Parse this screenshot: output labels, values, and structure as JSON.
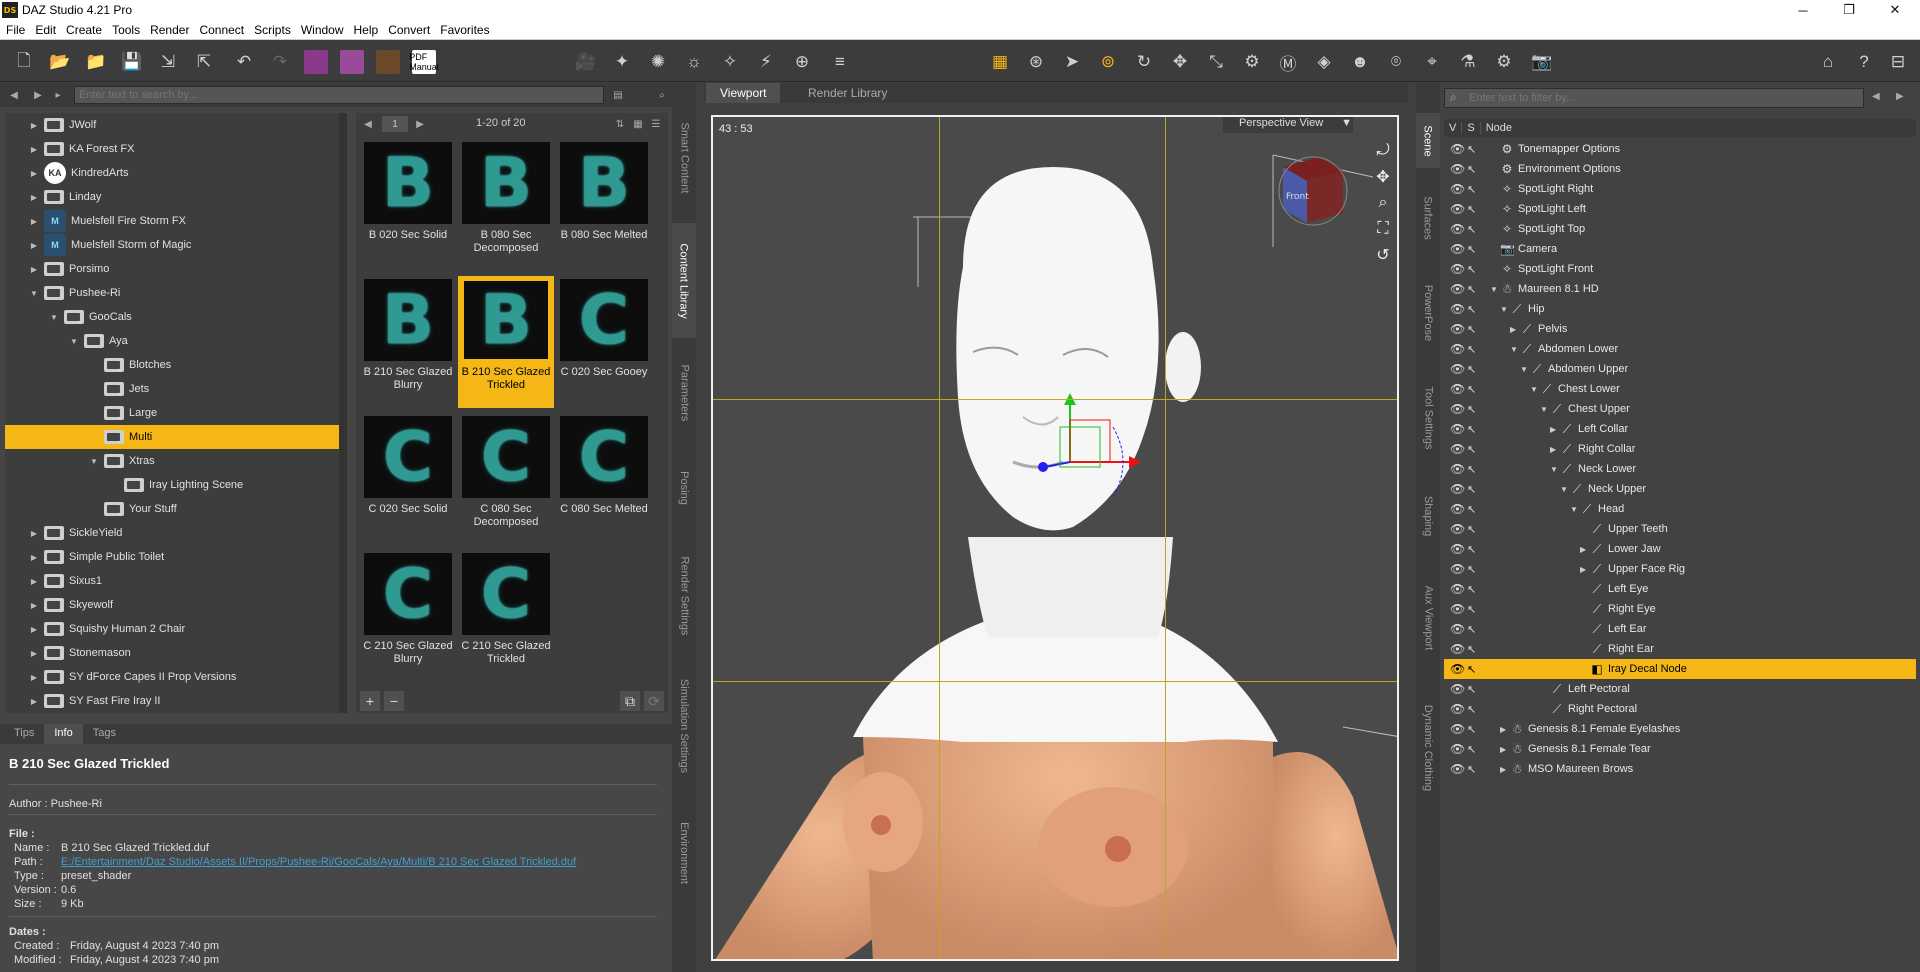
{
  "window": {
    "title": "DAZ Studio 4.21 Pro",
    "logo": "DS",
    "minimize": "─",
    "maximize": "❐",
    "close": "✕"
  },
  "menu": [
    "File",
    "Edit",
    "Create",
    "Tools",
    "Render",
    "Connect",
    "Scripts",
    "Window",
    "Help",
    "Convert",
    "Favorites"
  ],
  "toolbar": {
    "pdf_label": "PDF Manual"
  },
  "content": {
    "search_placeholder": "Enter text to search by...",
    "tree": [
      {
        "label": "JWolf",
        "depth": 0,
        "expander": "▶",
        "icon": "folder"
      },
      {
        "label": "KA Forest FX",
        "depth": 0,
        "expander": "▶",
        "icon": "folder"
      },
      {
        "label": "KindredArts",
        "depth": 0,
        "expander": "▶",
        "icon": "ka-logo",
        "badge": "KA"
      },
      {
        "label": "Linday",
        "depth": 0,
        "expander": "▶",
        "icon": "folder"
      },
      {
        "label": "Muelsfell Fire Storm FX",
        "depth": 0,
        "expander": "▶",
        "icon": "ms-logo",
        "badge": "M"
      },
      {
        "label": "Muelsfell Storm of Magic",
        "depth": 0,
        "expander": "▶",
        "icon": "ms-logo",
        "badge": "M"
      },
      {
        "label": "Porsimo",
        "depth": 0,
        "expander": "▶",
        "icon": "folder"
      },
      {
        "label": "Pushee-Ri",
        "depth": 0,
        "expander": "▼",
        "icon": "folder"
      },
      {
        "label": "GooCals",
        "depth": 1,
        "expander": "▼",
        "icon": "folder"
      },
      {
        "label": "Aya",
        "depth": 2,
        "expander": "▼",
        "icon": "folder"
      },
      {
        "label": "Blotches",
        "depth": 3,
        "expander": "",
        "icon": "folder"
      },
      {
        "label": "Jets",
        "depth": 3,
        "expander": "",
        "icon": "folder"
      },
      {
        "label": "Large",
        "depth": 3,
        "expander": "",
        "icon": "folder"
      },
      {
        "label": "Multi",
        "depth": 3,
        "expander": "",
        "icon": "folder",
        "selected": true
      },
      {
        "label": "Xtras",
        "depth": 3,
        "expander": "▼",
        "icon": "folder"
      },
      {
        "label": "Iray Lighting Scene",
        "depth": 4,
        "expander": "",
        "icon": "folder"
      },
      {
        "label": "Your Stuff",
        "depth": 3,
        "expander": "",
        "icon": "folder"
      },
      {
        "label": "SickleYield",
        "depth": 0,
        "expander": "▶",
        "icon": "folder"
      },
      {
        "label": "Simple Public Toilet",
        "depth": 0,
        "expander": "▶",
        "icon": "folder"
      },
      {
        "label": "Sixus1",
        "depth": 0,
        "expander": "▶",
        "icon": "folder"
      },
      {
        "label": "Skyewolf",
        "depth": 0,
        "expander": "▶",
        "icon": "folder"
      },
      {
        "label": "Squishy Human 2 Chair",
        "depth": 0,
        "expander": "▶",
        "icon": "folder"
      },
      {
        "label": "Stonemason",
        "depth": 0,
        "expander": "▶",
        "icon": "folder"
      },
      {
        "label": "SY dForce Capes II Prop Versions",
        "depth": 0,
        "expander": "▶",
        "icon": "folder"
      },
      {
        "label": "SY Fast Fire Iray II",
        "depth": 0,
        "expander": "▶",
        "icon": "folder"
      }
    ],
    "page": "1",
    "count": "1-20 of 20",
    "tiles": [
      {
        "letter": "B",
        "label": "B 020 Sec Solid"
      },
      {
        "letter": "B",
        "label": "B 080 Sec Decomposed"
      },
      {
        "letter": "B",
        "label": "B 080 Sec Melted"
      },
      {
        "letter": "B",
        "label": "B 210 Sec Glazed Blurry"
      },
      {
        "letter": "B",
        "label": "B 210 Sec Glazed Trickled",
        "selected": true
      },
      {
        "letter": "C",
        "label": "C 020 Sec Gooey"
      },
      {
        "letter": "C",
        "label": "C 020 Sec Solid"
      },
      {
        "letter": "C",
        "label": "C 080 Sec Decomposed"
      },
      {
        "letter": "C",
        "label": "C 080 Sec Melted"
      },
      {
        "letter": "C",
        "label": "C 210 Sec Glazed Blurry"
      },
      {
        "letter": "C",
        "label": "C 210 Sec Glazed Trickled"
      }
    ],
    "add": "+",
    "remove": "−"
  },
  "info_tabs": [
    {
      "label": "Tips"
    },
    {
      "label": "Info",
      "active": true
    },
    {
      "label": "Tags"
    }
  ],
  "info": {
    "title": "B 210 Sec Glazed Trickled",
    "author": "Author : Pushee-Ri",
    "file_header": "File :",
    "name_key": "Name :",
    "name": "B 210 Sec Glazed Trickled.duf",
    "path_key": "Path :",
    "path": "E:/Entertainment/Daz Studio/Assets II/Props/Pushee-Ri/GooCals/Aya/Multi/B 210 Sec Glazed Trickled.duf",
    "type_key": "Type :",
    "type": "preset_shader",
    "version_key": "Version :",
    "version": "0.6",
    "size_key": "Size :",
    "size": "9 Kb",
    "dates_header": "Dates :",
    "created_key": "Created :",
    "created": "Friday, August 4 2023 7:40 pm",
    "modified_key": "Modified :",
    "modified": "Friday, August 4 2023 7:40 pm"
  },
  "left_vtabs": [
    {
      "label": "Smart Content"
    },
    {
      "label": "Content Library",
      "active": true
    },
    {
      "label": "Parameters"
    },
    {
      "label": "Posing"
    },
    {
      "label": "Render Settings"
    },
    {
      "label": "Simulation Settings"
    },
    {
      "label": "Environment"
    }
  ],
  "viewport_tabs": [
    {
      "label": "Viewport",
      "active": true
    },
    {
      "label": "Render Library"
    }
  ],
  "viewport": {
    "readout": "43 : 53",
    "view": "Perspective View",
    "cube_label": "Front"
  },
  "right_vtabs": [
    {
      "label": "Scene",
      "active": true
    },
    {
      "label": "Surfaces"
    },
    {
      "label": "PowerPose"
    },
    {
      "label": "Tool Settings"
    },
    {
      "label": "Shaping"
    },
    {
      "label": "Aux Viewport"
    },
    {
      "label": "Dynamic Clothing"
    }
  ],
  "scene": {
    "filter_placeholder": "Enter text to filter by...",
    "col_v": "V",
    "col_s": "S",
    "col_node": "Node",
    "nodes": [
      {
        "label": "Tonemapper Options",
        "depth": 0,
        "expander": "",
        "icon": "options-icon"
      },
      {
        "label": "Environment Options",
        "depth": 0,
        "expander": "",
        "icon": "options-icon"
      },
      {
        "label": "SpotLight Right",
        "depth": 0,
        "expander": "",
        "icon": "spotlight-icon"
      },
      {
        "label": "SpotLight Left",
        "depth": 0,
        "expander": "",
        "icon": "spotlight-icon"
      },
      {
        "label": "SpotLight Top",
        "depth": 0,
        "expander": "",
        "icon": "spotlight-icon"
      },
      {
        "label": "Camera",
        "depth": 0,
        "expander": "",
        "icon": "camera-icon"
      },
      {
        "label": "SpotLight Front",
        "depth": 0,
        "expander": "",
        "icon": "spotlight-icon"
      },
      {
        "label": "Maureen 8.1 HD",
        "depth": 0,
        "expander": "▼",
        "icon": "figure-icon"
      },
      {
        "label": "Hip",
        "depth": 1,
        "expander": "▼",
        "icon": "bone-icon"
      },
      {
        "label": "Pelvis",
        "depth": 2,
        "expander": "▶",
        "icon": "bone-icon"
      },
      {
        "label": "Abdomen Lower",
        "depth": 2,
        "expander": "▼",
        "icon": "bone-icon"
      },
      {
        "label": "Abdomen Upper",
        "depth": 3,
        "expander": "▼",
        "icon": "bone-icon"
      },
      {
        "label": "Chest Lower",
        "depth": 4,
        "expander": "▼",
        "icon": "bone-icon"
      },
      {
        "label": "Chest Upper",
        "depth": 5,
        "expander": "▼",
        "icon": "bone-icon"
      },
      {
        "label": "Left Collar",
        "depth": 6,
        "expander": "▶",
        "icon": "bone-icon"
      },
      {
        "label": "Right Collar",
        "depth": 6,
        "expander": "▶",
        "icon": "bone-icon"
      },
      {
        "label": "Neck Lower",
        "depth": 6,
        "expander": "▼",
        "icon": "bone-icon"
      },
      {
        "label": "Neck Upper",
        "depth": 7,
        "expander": "▼",
        "icon": "bone-icon"
      },
      {
        "label": "Head",
        "depth": 8,
        "expander": "▼",
        "icon": "bone-icon"
      },
      {
        "label": "Upper Teeth",
        "depth": 9,
        "expander": "",
        "icon": "bone-icon"
      },
      {
        "label": "Lower Jaw",
        "depth": 9,
        "expander": "▶",
        "icon": "bone-icon"
      },
      {
        "label": "Upper Face Rig",
        "depth": 9,
        "expander": "▶",
        "icon": "bone-icon"
      },
      {
        "label": "Left Eye",
        "depth": 9,
        "expander": "",
        "icon": "bone-icon"
      },
      {
        "label": "Right Eye",
        "depth": 9,
        "expander": "",
        "icon": "bone-icon"
      },
      {
        "label": "Left Ear",
        "depth": 9,
        "expander": "",
        "icon": "bone-icon"
      },
      {
        "label": "Right Ear",
        "depth": 9,
        "expander": "",
        "icon": "bone-icon"
      },
      {
        "label": "Iray Decal Node",
        "depth": 9,
        "expander": "",
        "icon": "decal-icon",
        "selected": true
      },
      {
        "label": "Left Pectoral",
        "depth": 5,
        "expander": "",
        "icon": "bone-icon"
      },
      {
        "label": "Right Pectoral",
        "depth": 5,
        "expander": "",
        "icon": "bone-icon"
      },
      {
        "label": "Genesis 8.1 Female Eyelashes",
        "depth": 1,
        "expander": "▶",
        "icon": "figure-icon"
      },
      {
        "label": "Genesis 8.1 Female Tear",
        "depth": 1,
        "expander": "▶",
        "icon": "figure-icon"
      },
      {
        "label": "MSO Maureen Brows",
        "depth": 1,
        "expander": "▶",
        "icon": "figure-icon"
      }
    ]
  }
}
